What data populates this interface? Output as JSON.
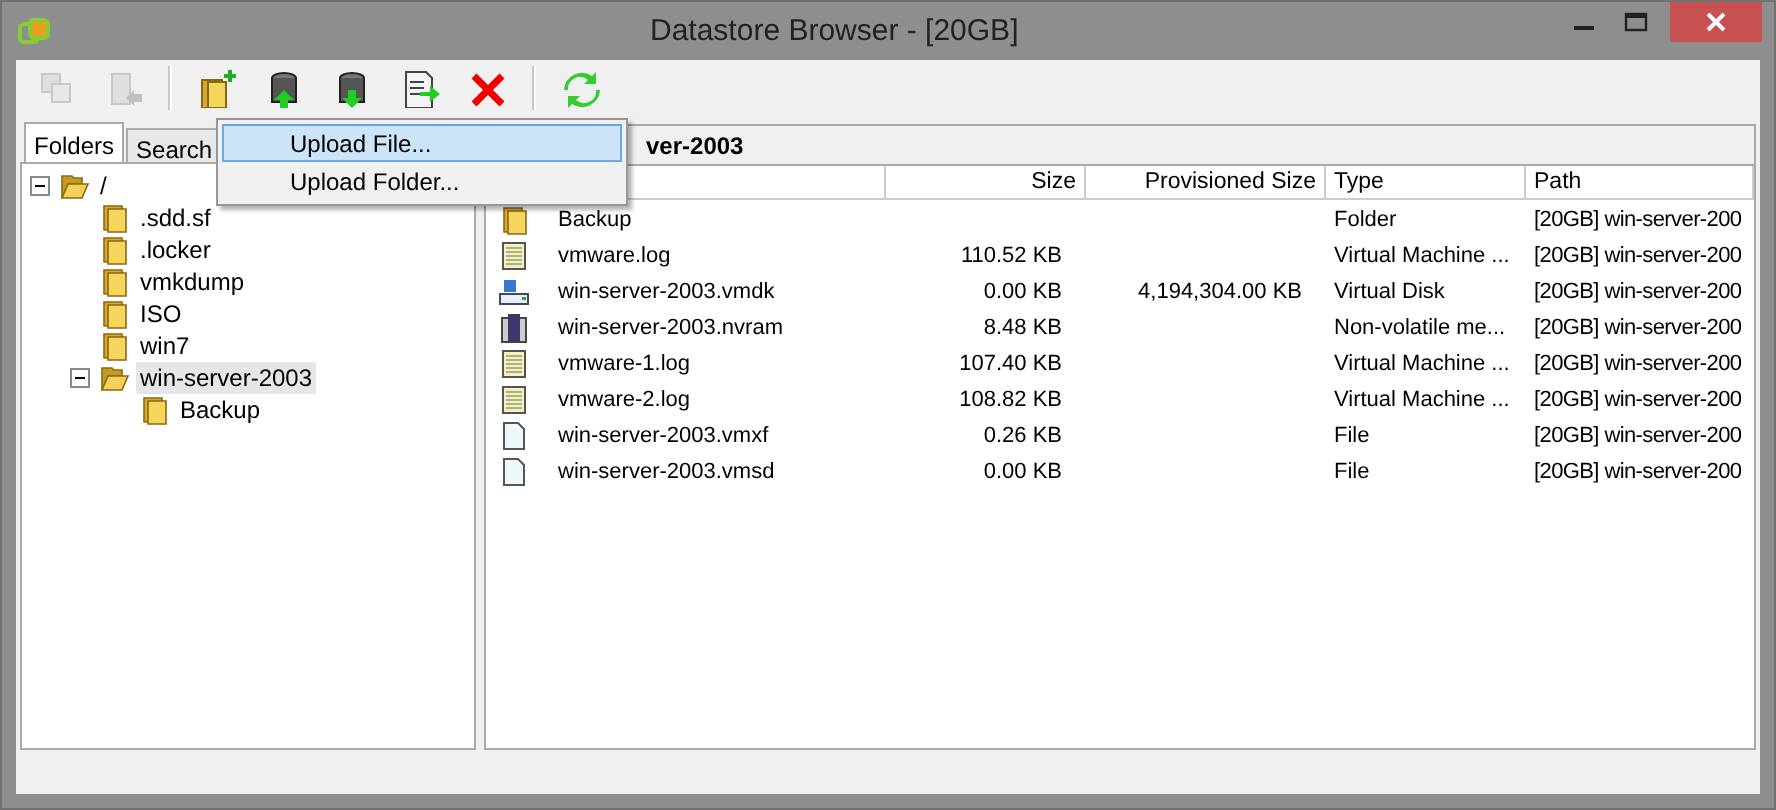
{
  "window": {
    "title": "Datastore Browser - [20GB]"
  },
  "toolbar": [
    {
      "kind": "copy",
      "disabled": true
    },
    {
      "kind": "move",
      "disabled": true
    },
    {
      "kind": "new-folder",
      "disabled": false
    },
    {
      "kind": "upload",
      "disabled": false
    },
    {
      "kind": "download",
      "disabled": false
    },
    {
      "kind": "export",
      "disabled": false
    },
    {
      "kind": "delete",
      "disabled": false
    },
    {
      "kind": "refresh",
      "disabled": false
    }
  ],
  "upload_menu": [
    {
      "label": "Upload File...",
      "selected": true
    },
    {
      "label": "Upload Folder...",
      "selected": false
    }
  ],
  "tabs": [
    {
      "label": "Folders",
      "selected": true
    },
    {
      "label": "Search",
      "selected": false
    }
  ],
  "tree": [
    {
      "label": "/",
      "expanded": true,
      "selected": false,
      "children": [
        {
          "label": ".sdd.sf",
          "selected": false
        },
        {
          "label": ".locker",
          "selected": false
        },
        {
          "label": "vmkdump",
          "selected": false
        },
        {
          "label": "ISO",
          "selected": false
        },
        {
          "label": "win7",
          "selected": false
        },
        {
          "label": "win-server-2003",
          "expanded": true,
          "selected": true,
          "children": [
            {
              "label": "Backup",
              "selected": false
            }
          ]
        }
      ]
    }
  ],
  "path_bar": "ver-2003",
  "table": {
    "columns": [
      "Size",
      "Provisioned Size",
      "Type",
      "Path"
    ],
    "rows": [
      {
        "kind": "folder",
        "name": "Backup",
        "type": "Folder",
        "path": "[20GB] win-server-200"
      },
      {
        "kind": "log",
        "name": "vmware.log",
        "size": "110.52 KB",
        "type": "Virtual Machine ...",
        "path": "[20GB] win-server-200"
      },
      {
        "kind": "disk",
        "name": "win-server-2003.vmdk",
        "size": "0.00 KB",
        "provisioned": "4,194,304.00 KB",
        "type": "Virtual Disk",
        "path": "[20GB] win-server-200"
      },
      {
        "kind": "nvram",
        "name": "win-server-2003.nvram",
        "size": "8.48 KB",
        "type": "Non-volatile me...",
        "path": "[20GB] win-server-200"
      },
      {
        "kind": "log",
        "name": "vmware-1.log",
        "size": "107.40 KB",
        "type": "Virtual Machine ...",
        "path": "[20GB] win-server-200"
      },
      {
        "kind": "log",
        "name": "vmware-2.log",
        "size": "108.82 KB",
        "type": "Virtual Machine ...",
        "path": "[20GB] win-server-200"
      },
      {
        "kind": "file",
        "name": "win-server-2003.vmxf",
        "size": "0.26 KB",
        "type": "File",
        "path": "[20GB] win-server-200"
      },
      {
        "kind": "file",
        "name": "win-server-2003.vmsd",
        "size": "0.00 KB",
        "type": "File",
        "path": "[20GB] win-server-200"
      }
    ]
  }
}
